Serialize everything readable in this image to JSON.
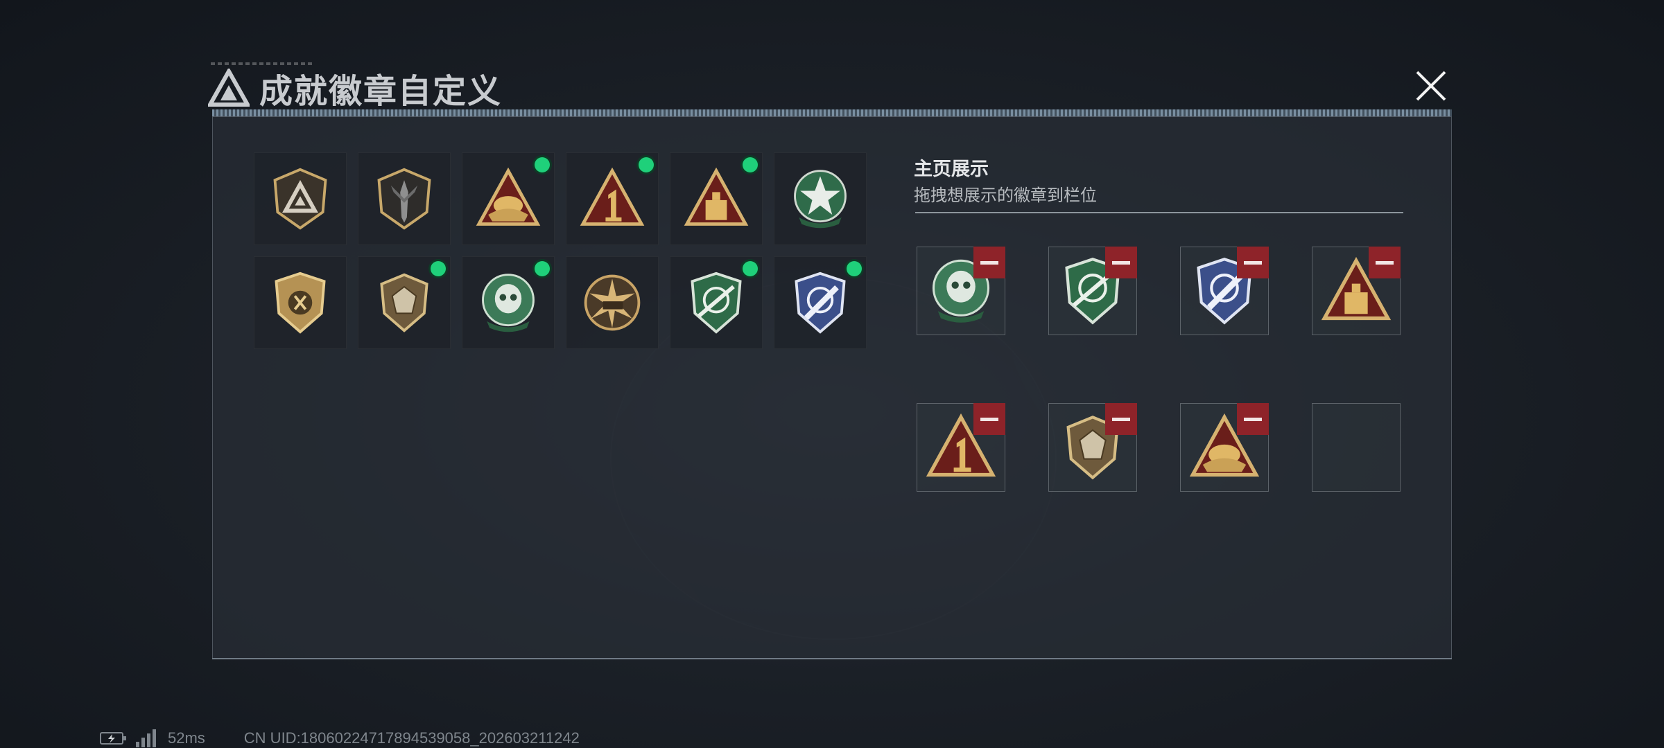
{
  "header": {
    "title": "成就徽章自定义",
    "close_icon": "close-icon",
    "logo_icon": "triangle-logo-icon"
  },
  "badges": [
    {
      "icon": "triangle-shield-badge-icon",
      "new": false
    },
    {
      "icon": "dagger-shield-badge-icon",
      "new": false
    },
    {
      "icon": "hand-triangle-badge-icon",
      "new": true
    },
    {
      "icon": "number-one-triangle-badge-icon",
      "new": true
    },
    {
      "icon": "crate-triangle-badge-icon",
      "new": true
    },
    {
      "icon": "star-laurel-badge-icon",
      "new": false
    },
    {
      "icon": "split-shield-badge-icon",
      "new": false
    },
    {
      "icon": "gem-shield-badge-icon",
      "new": true
    },
    {
      "icon": "skull-laurel-badge-icon",
      "new": true
    },
    {
      "icon": "tank-burst-badge-icon",
      "new": false
    },
    {
      "icon": "sniper-crosshair-green-badge-icon",
      "new": true
    },
    {
      "icon": "knife-crosshair-blue-badge-icon",
      "new": true
    }
  ],
  "showcase": {
    "title": "主页展示",
    "subtitle": "拖拽想展示的徽章到栏位",
    "slots": [
      {
        "icon": "skull-laurel-badge-icon",
        "filled": true
      },
      {
        "icon": "sniper-crosshair-green-badge-icon",
        "filled": true
      },
      {
        "icon": "knife-crosshair-blue-badge-icon",
        "filled": true
      },
      {
        "icon": "crate-triangle-badge-icon",
        "filled": true
      },
      {
        "icon": "number-one-triangle-badge-icon",
        "filled": true
      },
      {
        "icon": "gem-shield-badge-icon",
        "filled": true
      },
      {
        "icon": "hand-triangle-badge-icon",
        "filled": true
      },
      {
        "icon": "",
        "filled": false
      }
    ]
  },
  "status": {
    "battery_icon": "battery-charging-icon",
    "signal_icon": "signal-bars-icon",
    "ping": "52ms",
    "uid": "CN UID:18060224717894539058_202603211242"
  },
  "colors": {
    "new_dot": "#1fd07a",
    "remove_button": "#8e2329"
  }
}
